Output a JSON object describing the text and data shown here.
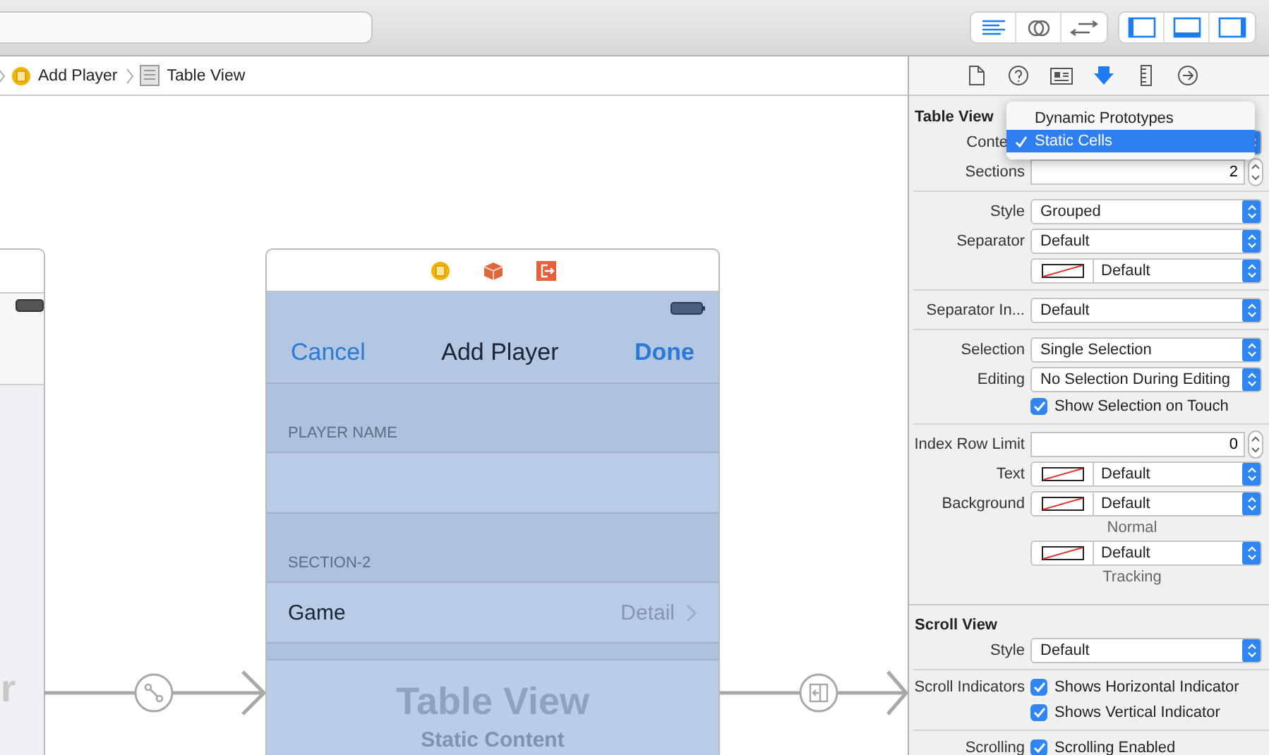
{
  "toolbar": {
    "editor_modes": [
      {
        "kind": "standard",
        "selected": true
      },
      {
        "kind": "assistant",
        "selected": false
      },
      {
        "kind": "version",
        "selected": false
      }
    ],
    "panels": [
      {
        "kind": "left",
        "on": true
      },
      {
        "kind": "bottom",
        "on": true
      },
      {
        "kind": "right",
        "on": true
      }
    ]
  },
  "breadcrumb": [
    {
      "kind": "controller",
      "label": "Add Player"
    },
    {
      "kind": "table",
      "label": "Table View"
    }
  ],
  "canvas": {
    "partial_scene": {
      "title": "r"
    },
    "scene": {
      "nav": {
        "left": "Cancel",
        "title": "Add Player",
        "right": "Done"
      },
      "sections": [
        {
          "header": "PLAYER NAME",
          "cells": [
            {
              "kind": "blank"
            }
          ]
        },
        {
          "header": "SECTION-2",
          "cells": [
            {
              "kind": "detail",
              "title": "Game",
              "detail": "Detail"
            }
          ]
        }
      ],
      "placeholder": {
        "title": "Table View",
        "subtitle": "Static Content"
      }
    },
    "segues": [
      {
        "kind": "push"
      },
      {
        "kind": "embed"
      }
    ]
  },
  "inspector": {
    "tabs": [
      {
        "kind": "file",
        "selected": false
      },
      {
        "kind": "help",
        "selected": false
      },
      {
        "kind": "identity",
        "selected": false
      },
      {
        "kind": "attributes",
        "selected": true
      },
      {
        "kind": "size",
        "selected": false
      },
      {
        "kind": "connections",
        "selected": false
      }
    ],
    "menu": [
      {
        "label": "Dynamic Prototypes",
        "selected": false
      },
      {
        "label": "Static Cells",
        "selected": true
      }
    ],
    "sections": [
      {
        "title": "Table View",
        "rows": [
          {
            "kind": "popup",
            "label": "Conte"
          },
          {
            "kind": "number",
            "label": "Sections",
            "value": "2"
          },
          {
            "kind": "divider"
          },
          {
            "kind": "popup",
            "label": "Style",
            "value": "Grouped"
          },
          {
            "kind": "popup",
            "label": "Separator",
            "value": "Default"
          },
          {
            "kind": "color",
            "value": "Default"
          },
          {
            "kind": "divider"
          },
          {
            "kind": "popup",
            "label": "Separator In...",
            "value": "Default"
          },
          {
            "kind": "divider"
          },
          {
            "kind": "popup",
            "label": "Selection",
            "value": "Single Selection"
          },
          {
            "kind": "popup",
            "label": "Editing",
            "value": "No Selection During Editing"
          },
          {
            "kind": "checkbox",
            "text": "Show Selection on Touch",
            "checked": true
          },
          {
            "kind": "divider"
          },
          {
            "kind": "number",
            "label": "Index Row Limit",
            "value": "0"
          },
          {
            "kind": "color",
            "label": "Text",
            "value": "Default"
          },
          {
            "kind": "color",
            "label": "Background",
            "value": "Default"
          },
          {
            "kind": "caption",
            "text": "Normal"
          },
          {
            "kind": "color",
            "value": "Default"
          },
          {
            "kind": "caption",
            "text": "Tracking"
          }
        ]
      },
      {
        "title": "Scroll View",
        "rows": [
          {
            "kind": "popup",
            "label": "Style",
            "value": "Default"
          },
          {
            "kind": "divider"
          },
          {
            "kind": "checkbox",
            "label": "Scroll Indicators",
            "text": "Shows Horizontal Indicator",
            "checked": true
          },
          {
            "kind": "checkbox",
            "text": "Shows Vertical Indicator",
            "checked": true
          },
          {
            "kind": "divider"
          },
          {
            "kind": "checkbox",
            "label": "Scrolling",
            "text": "Scrolling Enabled",
            "checked": true
          }
        ]
      }
    ]
  }
}
